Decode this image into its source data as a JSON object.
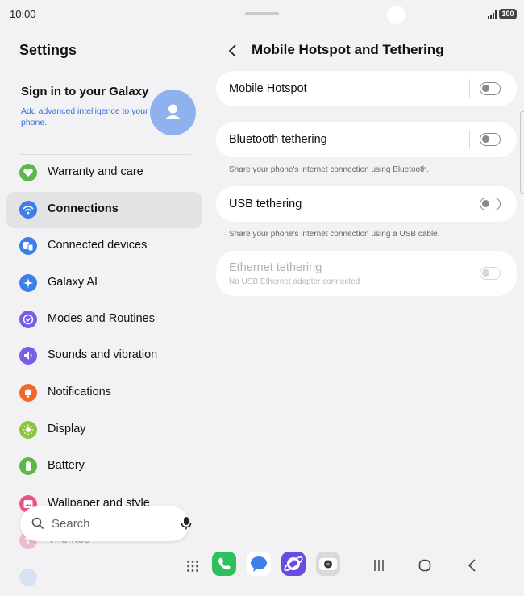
{
  "status": {
    "time": "10:00",
    "battery": "100"
  },
  "sidebar": {
    "title": "Settings",
    "account": {
      "title": "Sign in to your Galaxy",
      "subtitle": "Add advanced intelligence to your phone."
    },
    "items": [
      {
        "label": "Warranty and care",
        "icon": "warranty-heart-icon",
        "color": "#5cb848"
      },
      {
        "label": "Connections",
        "icon": "wifi-icon",
        "color": "#3d7fe8",
        "active": true
      },
      {
        "label": "Connected devices",
        "icon": "connected-devices-icon",
        "color": "#3d7fe8"
      },
      {
        "label": "Galaxy AI",
        "icon": "galaxy-ai-sparkle-icon",
        "color": "#3d7fe8"
      },
      {
        "label": "Modes and Routines",
        "icon": "modes-check-icon",
        "color": "#7b5ce6"
      },
      {
        "label": "Sounds and vibration",
        "icon": "speaker-icon",
        "color": "#7b5ce6"
      },
      {
        "label": "Notifications",
        "icon": "bell-icon",
        "color": "#ef6a2a"
      },
      {
        "label": "Display",
        "icon": "sun-icon",
        "color": "#8cc63f"
      },
      {
        "label": "Battery",
        "icon": "battery-icon",
        "color": "#5cb848"
      },
      {
        "label": "Wallpaper and style",
        "icon": "wallpaper-icon",
        "color": "#e8548a"
      },
      {
        "label": "Themes",
        "icon": "themes-icon",
        "color": "#e8548a"
      }
    ]
  },
  "search": {
    "placeholder": "Search"
  },
  "page": {
    "title": "Mobile Hotspot and Tethering",
    "options": [
      {
        "label": "Mobile Hotspot",
        "enabled": false
      },
      {
        "label": "Bluetooth tethering",
        "description": "Share your phone's internet connection using Bluetooth.",
        "enabled": false
      },
      {
        "label": "USB tethering",
        "description": "Share your phone's internet connection using a USB cable.",
        "enabled": false
      },
      {
        "label": "Ethernet tethering",
        "description": "No USB Ethernet adapter connected",
        "enabled": false,
        "disabled": true
      }
    ]
  },
  "dock": {
    "apps": [
      {
        "name": "phone-app-icon",
        "color": "#2ec05c"
      },
      {
        "name": "messages-app-icon",
        "color": "#3d7fe8"
      },
      {
        "name": "internet-app-icon",
        "color": "#6a4de0"
      },
      {
        "name": "camera-app-icon",
        "color": "#d9d9dc"
      }
    ]
  }
}
